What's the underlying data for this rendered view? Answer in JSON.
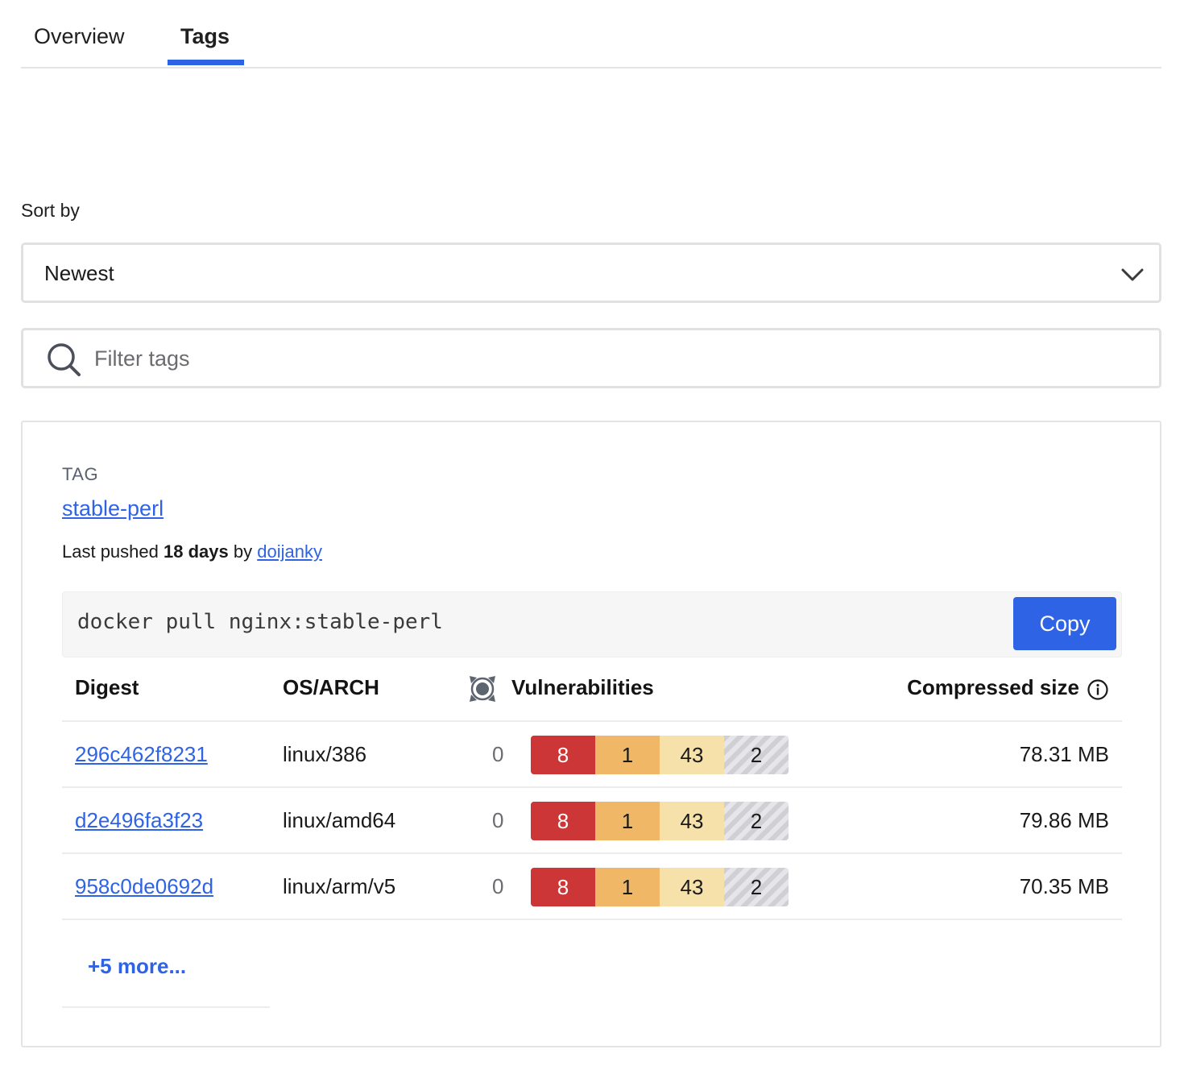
{
  "tabs": [
    {
      "label": "Overview",
      "active": false
    },
    {
      "label": "Tags",
      "active": true
    }
  ],
  "sort": {
    "label": "Sort by",
    "selected": "Newest"
  },
  "filter": {
    "placeholder": "Filter tags",
    "value": ""
  },
  "tag_card": {
    "caption": "TAG",
    "name": "stable-perl",
    "pushed_prefix": "Last pushed",
    "pushed_age": "18 days",
    "pushed_by_word": "by",
    "pushed_by_user": "doijanky",
    "pull_command": "docker pull nginx:stable-perl",
    "copy_label": "Copy",
    "columns": {
      "digest": "Digest",
      "os_arch": "OS/ARCH",
      "vulnerabilities": "Vulnerabilities",
      "compressed_size": "Compressed size"
    },
    "rows": [
      {
        "digest": "296c462f8231",
        "os_arch": "linux/386",
        "unknown": "0",
        "critical": "8",
        "high": "1",
        "medium": "43",
        "low": "2",
        "size": "78.31 MB"
      },
      {
        "digest": "d2e496fa3f23",
        "os_arch": "linux/amd64",
        "unknown": "0",
        "critical": "8",
        "high": "1",
        "medium": "43",
        "low": "2",
        "size": "79.86 MB"
      },
      {
        "digest": "958c0de0692d",
        "os_arch": "linux/arm/v5",
        "unknown": "0",
        "critical": "8",
        "high": "1",
        "medium": "43",
        "low": "2",
        "size": "70.35 MB"
      }
    ],
    "more_label": "+5 more..."
  },
  "colors": {
    "accent": "#2f63e6",
    "critical": "#cc3636",
    "high": "#f0b866",
    "medium": "#f7e1ab",
    "low": "#dadade"
  }
}
